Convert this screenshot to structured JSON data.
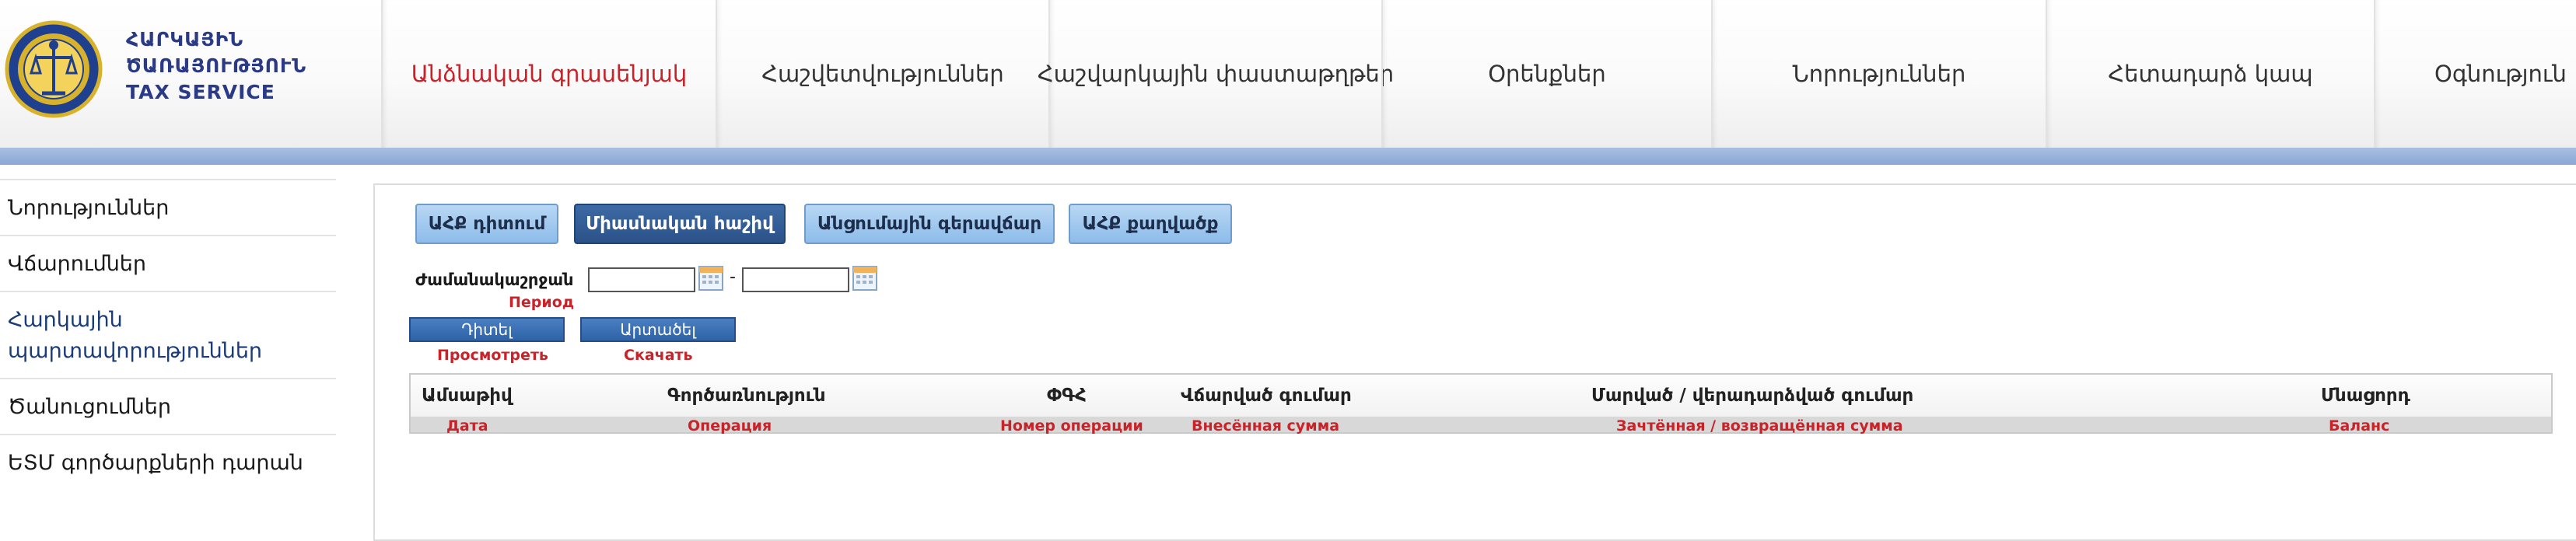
{
  "header": {
    "brand_line1": "ՀԱՐԿԱՅԻՆ",
    "brand_line2": "ԾԱՌԱՅՈՒԹՅՈՒՆ",
    "brand_line3": "TAX SERVICE",
    "nav": [
      {
        "label": "Անձնական գրասենյակ",
        "active": true
      },
      {
        "label": "Հաշվետվություններ",
        "active": false
      },
      {
        "label": "Հաշվարկային փաստաթղթեր",
        "active": false
      },
      {
        "label": "Օրենքներ",
        "active": false
      },
      {
        "label": "Նորություններ",
        "active": false
      },
      {
        "label": "Հետադարձ կապ",
        "active": false
      },
      {
        "label": "Օգնություն",
        "active": false
      }
    ]
  },
  "sidebar": {
    "items": [
      {
        "label": "Նորություններ"
      },
      {
        "label": "Վճարումներ"
      },
      {
        "label": "Հարկային պարտավորություններ"
      },
      {
        "label": "Ծանուցումներ"
      },
      {
        "label": "ԵՏՄ գործարքների դարան"
      }
    ]
  },
  "tabs": [
    {
      "label": "ԱՀՔ դիտում"
    },
    {
      "label": "Միասնական հաշիվ"
    },
    {
      "label": "Անցումային գերավճար"
    },
    {
      "label": "ԱՀՔ քաղվածք"
    }
  ],
  "filter": {
    "period_label": "Ժամանակաշրջան",
    "period_sub": "Период",
    "from_value": "",
    "to_value": "",
    "separator": "-"
  },
  "actions": {
    "view_label": "Դիտել",
    "view_sub": "Просмотреть",
    "export_label": "Արտածել",
    "export_sub": "Скачать"
  },
  "table": {
    "columns": [
      {
        "label": "Ամսաթիվ",
        "sub": "Дата"
      },
      {
        "label": "Գործառնություն",
        "sub": "Операция"
      },
      {
        "label": "ՓԳՀ",
        "sub": "Номер операции"
      },
      {
        "label": "Վճարված գումար",
        "sub": "Внесённая сумма"
      },
      {
        "label": "Մարված / վերադարձված գումար",
        "sub": "Зачтённая / возвращённая сумма"
      },
      {
        "label": "Մնացորդ",
        "sub": "Баланс"
      }
    ]
  },
  "colors": {
    "accent_red": "#c9232a",
    "brand_blue": "#2b3a86",
    "tab_active": "#2b5289",
    "band_blue": "#8aa7d6"
  }
}
